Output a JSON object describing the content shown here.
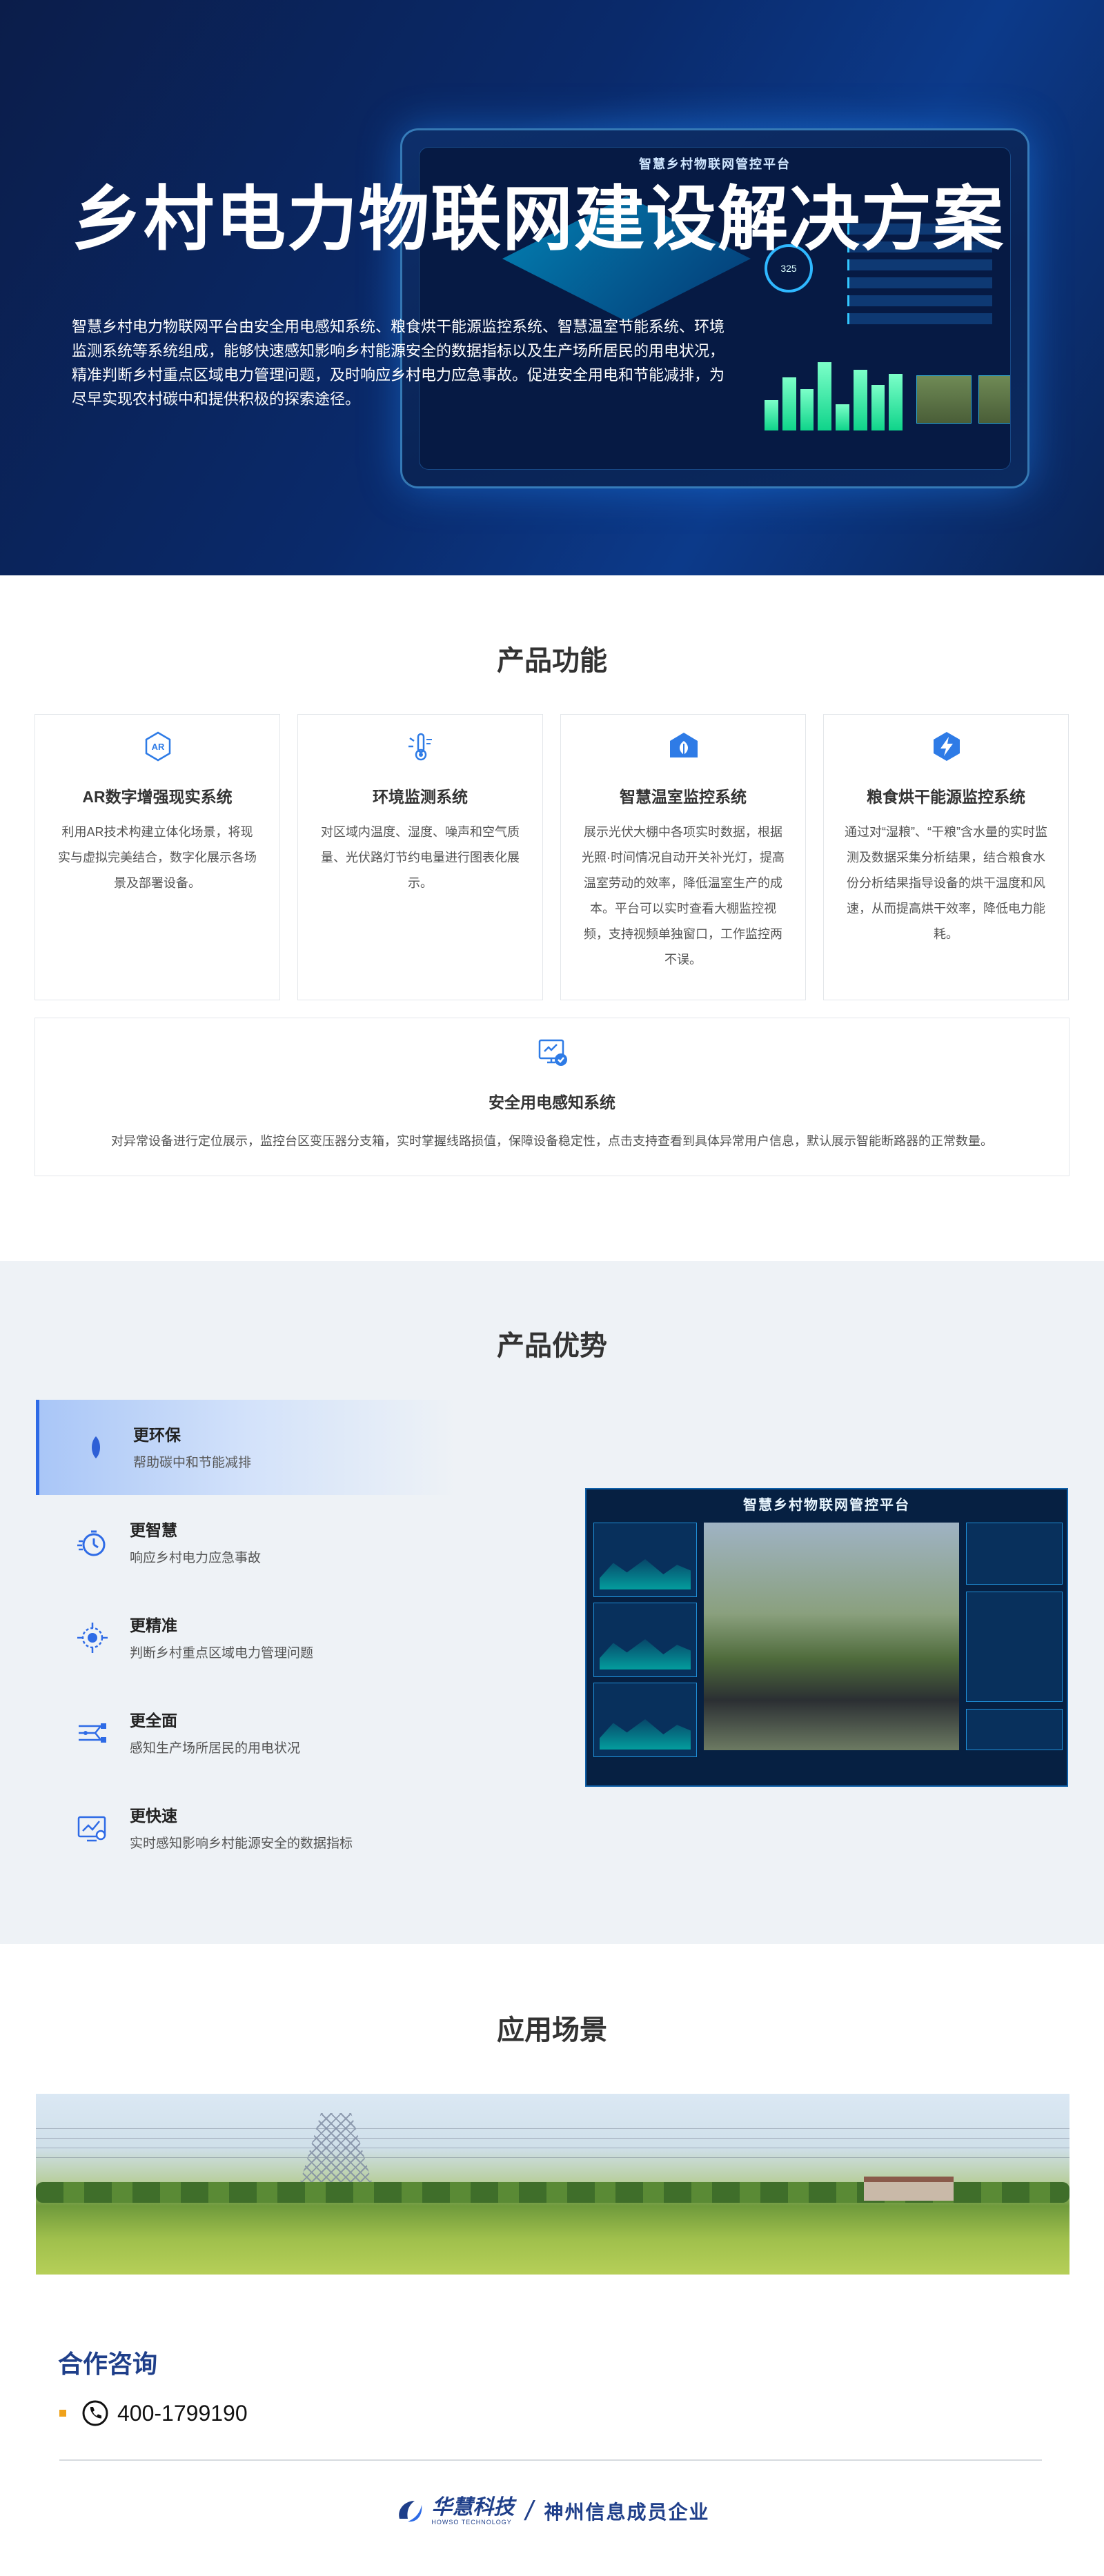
{
  "hero": {
    "title": "乡村电力物联网建设解决方案",
    "description": "智慧乡村电力物联网平台由安全用电感知系统、粮食烘干能源监控系统、智慧温室节能系统、环境监测系统等系统组成，能够快速感知影响乡村能源安全的数据指标以及生产场所居民的用电状况，精准判断乡村重点区域电力管理问题，及时响应乡村电力应急事故。促进安全用电和节能减排，为尽早实现农村碳中和提供积极的探索途径。",
    "device_title": "智慧乡村物联网管控平台",
    "device_gauge": "325"
  },
  "features": {
    "title": "产品功能",
    "items": [
      {
        "name": "AR数字增强现实系统",
        "icon": "ar-icon",
        "desc": "利用AR技术构建立体化场景，将现实与虚拟完美结合，数字化展示各场景及部署设备。"
      },
      {
        "name": "环境监测系统",
        "icon": "thermometer-icon",
        "desc": "对区域内温度、湿度、噪声和空气质量、光伏路灯节约电量进行图表化展示。"
      },
      {
        "name": "智慧温室监控系统",
        "icon": "greenhouse-icon",
        "desc": "展示光伏大棚中各项实时数据，根据光照·时间情况自动开关补光灯，提高温室劳动的效率，降低温室生产的成本。平台可以实时查看大棚监控视频，支持视频单独窗口，工作监控两不误。"
      },
      {
        "name": "粮食烘干能源监控系统",
        "icon": "energy-bolt-icon",
        "desc": "通过对“湿粮”、“干粮”含水量的实时监测及数据采集分析结果，结合粮食水份分析结果指导设备的烘干温度和风速，从而提高烘干效率，降低电力能耗。"
      }
    ],
    "wide": {
      "name": "安全用电感知系统",
      "icon": "monitor-check-icon",
      "desc": "对异常设备进行定位展示，监控台区变压器分支箱，实时掌握线路损值，保障设备稳定性，点击支持查看到具体异常用户信息，默认展示智能断路器的正常数量。"
    }
  },
  "advantages": {
    "title": "产品优势",
    "items": [
      {
        "name": "更环保",
        "desc": "帮助碳中和节能减排",
        "icon": "leaf-icon"
      },
      {
        "name": "更智慧",
        "desc": "响应乡村电力应急事故",
        "icon": "stopwatch-icon"
      },
      {
        "name": "更精准",
        "desc": "判断乡村重点区域电力管理问题",
        "icon": "target-icon"
      },
      {
        "name": "更全面",
        "desc": "感知生产场所居民的用电状况",
        "icon": "network-icon"
      },
      {
        "name": "更快速",
        "desc": "实时感知影响乡村能源安全的数据指标",
        "icon": "chart-monitor-icon"
      }
    ],
    "screen_title": "智慧乡村物联网管控平台"
  },
  "scenes": {
    "title": "应用场景"
  },
  "contact": {
    "title": "合作咨询",
    "phone": "400-1799190"
  },
  "footer": {
    "brand": "华慧科技",
    "brand_en": "HOWSO TECHNOLOGY",
    "slash": "/",
    "tag": "神州信息成员企业"
  },
  "colors": {
    "accent": "#2e6be6",
    "brand": "#1f3f8a",
    "hero_bg": "#0a2a6b"
  }
}
